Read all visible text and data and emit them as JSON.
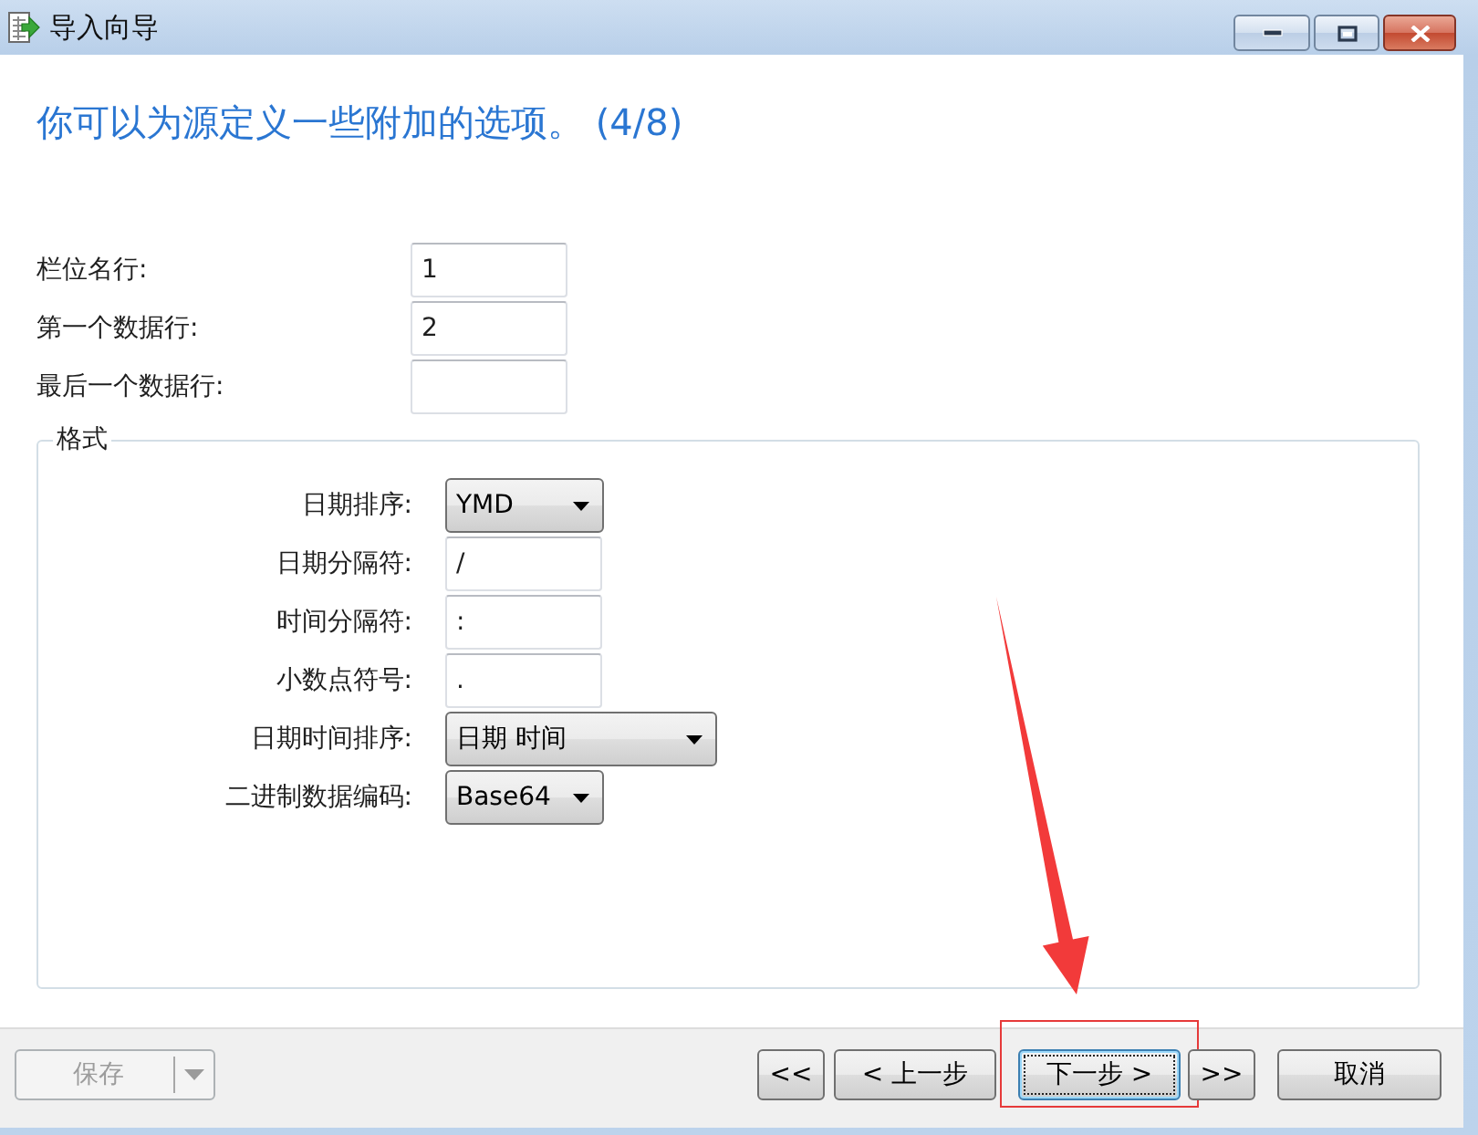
{
  "window": {
    "title": "导入向导"
  },
  "heading": "你可以为源定义一些附加的选项。 (4/8)",
  "row_fields": [
    {
      "label": "栏位名行:",
      "value": "1"
    },
    {
      "label": "第一个数据行:",
      "value": "2"
    },
    {
      "label": "最后一个数据行:"
    }
  ],
  "format_group": {
    "title": "格式",
    "fields": [
      {
        "label": "日期排序:",
        "kind": "dropdown",
        "value": "YMD"
      },
      {
        "label": "日期分隔符:",
        "kind": "text",
        "value": "/"
      },
      {
        "label": "时间分隔符:",
        "kind": "text",
        "value": ":"
      },
      {
        "label": "小数点符号:",
        "kind": "text",
        "value": "."
      },
      {
        "label": "日期时间排序:",
        "kind": "dropdown",
        "value": "日期 时间"
      },
      {
        "label": "二进制数据编码:",
        "kind": "dropdown",
        "value": "Base64"
      }
    ]
  },
  "footer": {
    "save": {
      "label": "保存",
      "disabled": true
    },
    "buttons": [
      {
        "label": "<<",
        "focused": false,
        "highlighted": false
      },
      {
        "label": "< 上一步",
        "focused": false,
        "highlighted": false
      },
      {
        "label": "下一步 >",
        "focused": true,
        "highlighted": true
      },
      {
        "label": ">>",
        "focused": false,
        "highlighted": false
      },
      {
        "label": "取消",
        "focused": false,
        "highlighted": false
      }
    ]
  }
}
